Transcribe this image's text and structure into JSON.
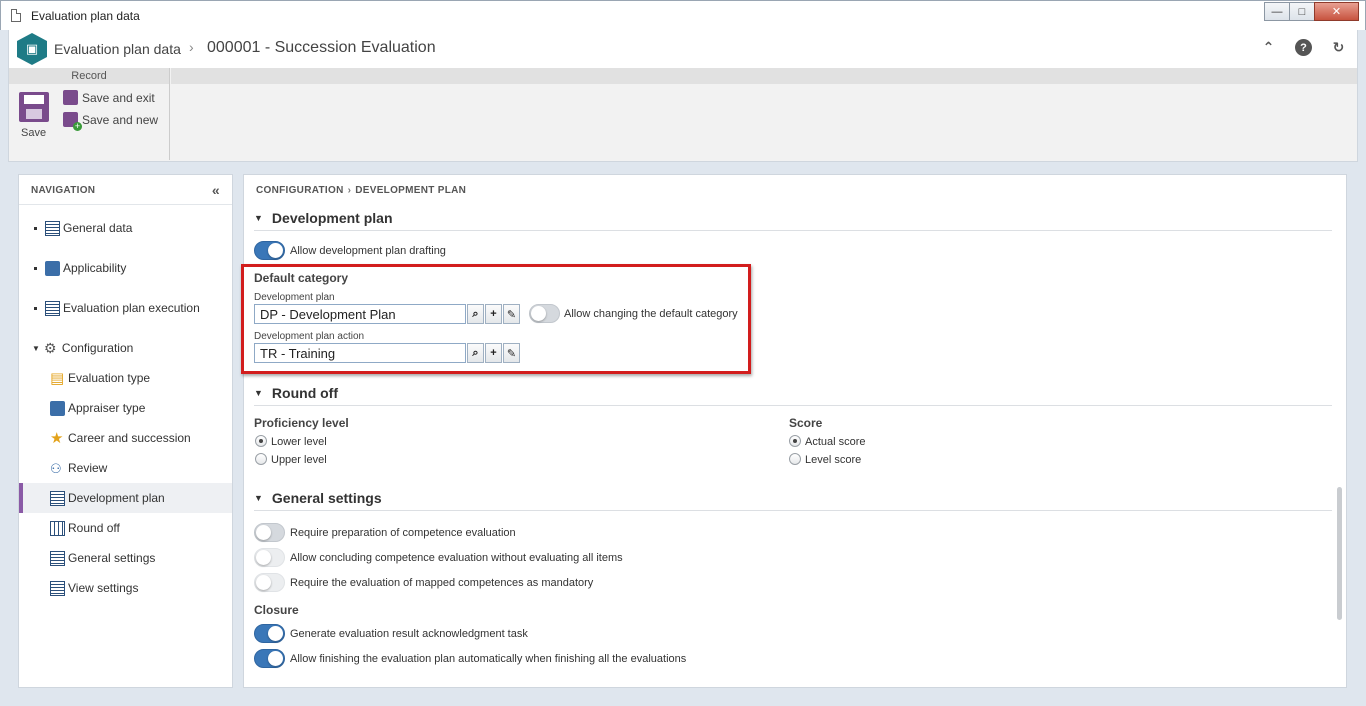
{
  "window": {
    "title": "Evaluation plan data",
    "minimize": "—",
    "maximize": "□",
    "close": "✕"
  },
  "header": {
    "breadcrumb_root": "Evaluation plan data",
    "separator": "›",
    "record_title": "000001 - Succession Evaluation",
    "icons": [
      "collapse-up-icon",
      "help-icon",
      "refresh-icon"
    ],
    "accent_color": "#1e7b86"
  },
  "ribbon": {
    "group_label": "Record",
    "save_label": "Save",
    "save_exit_label": "Save and exit",
    "save_new_label": "Save and new"
  },
  "nav": {
    "title": "NAVIGATION",
    "collapse_glyph": "«",
    "items": [
      {
        "label": "General data",
        "icon": "list-icon"
      },
      {
        "label": "Applicability",
        "icon": "applicability-icon"
      },
      {
        "label": "Evaluation plan execution",
        "icon": "execution-icon"
      },
      {
        "label": "Configuration",
        "icon": "gear-icon",
        "expanded": true
      }
    ],
    "sub_items": [
      {
        "label": "Evaluation type",
        "icon": "evaluation-type-icon"
      },
      {
        "label": "Appraiser type",
        "icon": "appraiser-icon"
      },
      {
        "label": "Career and succession",
        "icon": "star-icon"
      },
      {
        "label": "Review",
        "icon": "people-icon"
      },
      {
        "label": "Development plan",
        "icon": "development-plan-icon",
        "active": true
      },
      {
        "label": "Round off",
        "icon": "calculator-icon"
      },
      {
        "label": "General settings",
        "icon": "settings-icon"
      },
      {
        "label": "View settings",
        "icon": "view-settings-icon"
      }
    ],
    "active_color": "#8a5aa6"
  },
  "main": {
    "crumbs": [
      "CONFIGURATION",
      "DEVELOPMENT PLAN"
    ],
    "crumb_separator": "›",
    "development_plan": {
      "title": "Development plan",
      "allow_drafting_label": "Allow development plan drafting",
      "allow_drafting_on": true,
      "default_category_label": "Default category",
      "plan_field_label": "Development plan",
      "plan_field_value": "DP - Development Plan",
      "action_field_label": "Development plan action",
      "action_field_value": "TR - Training",
      "allow_change_label": "Allow changing the default category",
      "allow_change_on": false
    },
    "round_off": {
      "title": "Round off",
      "proficiency_label": "Proficiency level",
      "proficiency_options": [
        "Lower level",
        "Upper level"
      ],
      "proficiency_selected": "Lower level",
      "score_label": "Score",
      "score_options": [
        "Actual score",
        "Level score"
      ],
      "score_selected": "Actual score"
    },
    "general_settings": {
      "title": "General settings",
      "toggles": [
        {
          "label": "Require preparation of competence evaluation",
          "on": false
        },
        {
          "label": "Allow concluding competence evaluation without evaluating all items",
          "on": false
        },
        {
          "label": "Require the evaluation of mapped competences as mandatory",
          "on": false
        }
      ],
      "closure_label": "Closure",
      "closure_toggles": [
        {
          "label": "Generate evaluation result acknowledgment task",
          "on": true
        },
        {
          "label": "Allow finishing the evaluation plan automatically when finishing all the evaluations",
          "on": true
        }
      ]
    },
    "highlight_color": "#d21d1d"
  }
}
